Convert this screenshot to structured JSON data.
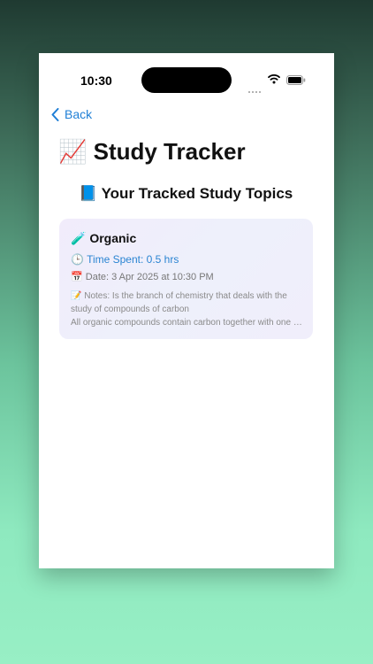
{
  "status_bar": {
    "time": "10:30"
  },
  "nav": {
    "back_label": "Back"
  },
  "page": {
    "title_icon": "📈",
    "title": "Study Tracker",
    "subtitle_icon": "📘",
    "subtitle": "Your Tracked Study Topics"
  },
  "topics": [
    {
      "icon": "🧪",
      "name": "Organic",
      "time_icon": "🕒",
      "time_spent": "Time Spent: 0.5 hrs",
      "date_icon": "📅",
      "date": "Date: 3 Apr 2025 at 10:30 PM",
      "notes_icon": "📝",
      "notes_line1": "Notes: Is the branch of chemistry that deals with the study of compounds of carbon",
      "notes_line2": "All organic compounds contain carbon together with one or more other elements"
    }
  ],
  "colors": {
    "accent": "#1f7fd6",
    "time_spent": "#2a84d2",
    "card_bg": "#f0eefb"
  }
}
